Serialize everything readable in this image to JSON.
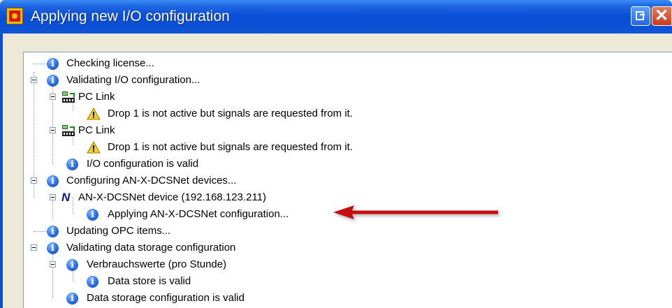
{
  "window": {
    "title": "Applying new I/O configuration",
    "accent": "#0a50d8"
  },
  "tree": [
    {
      "label": "Checking license...",
      "icon": "info-icon"
    },
    {
      "label": "Validating I/O configuration...",
      "icon": "info-icon",
      "expanded": true
    },
    {
      "label": "PC Link",
      "icon": "pc-link-icon",
      "expanded": true
    },
    {
      "label": "Drop 1 is not active but signals are requested from it.",
      "icon": "warning-icon"
    },
    {
      "label": "PC Link",
      "icon": "pc-link-icon",
      "expanded": true
    },
    {
      "label": "Drop 1 is not active but signals are requested from it.",
      "icon": "warning-icon"
    },
    {
      "label": "I/O configuration is valid",
      "icon": "info-icon"
    },
    {
      "label": "Configuring AN-X-DCSNet devices...",
      "icon": "info-icon",
      "expanded": true
    },
    {
      "label": "AN-X-DCSNet device (192.168.123.211)",
      "icon": "anx-device-icon",
      "expanded": true
    },
    {
      "label": "Applying AN-X-DCSNet configuration...",
      "icon": "info-icon"
    },
    {
      "label": "Updating OPC items...",
      "icon": "info-icon"
    },
    {
      "label": "Validating data storage configuration",
      "icon": "info-icon",
      "expanded": true
    },
    {
      "label": "Verbrauchswerte (pro Stunde)",
      "icon": "info-icon",
      "expanded": true
    },
    {
      "label": "Data store is valid",
      "icon": "info-icon"
    },
    {
      "label": "Data storage configuration is valid",
      "icon": "info-icon"
    }
  ],
  "annotation": {
    "icon": "red-arrow-icon",
    "color": "#c41010"
  }
}
